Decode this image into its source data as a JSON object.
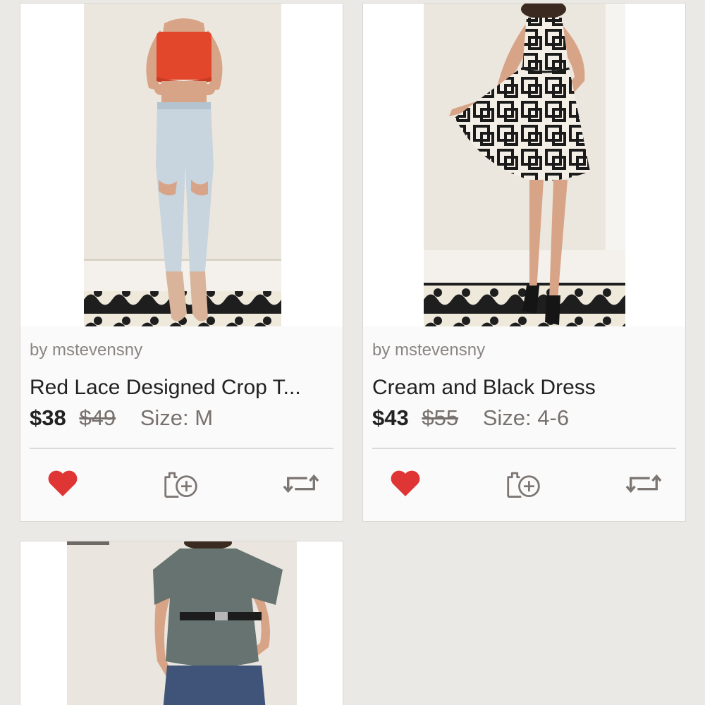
{
  "colors": {
    "background": "#ebe9e5",
    "card": "#ffffff",
    "heart": "#e03535",
    "icon_gray": "#7c7673",
    "text": "#222222",
    "muted": "#77716e"
  },
  "listings": [
    {
      "seller": "by mstevensny",
      "title": "Red Lace Designed Crop T...",
      "price": "$38",
      "original_price": "$49",
      "size": "Size: M",
      "image_alt": "Woman in red lace crop top and light ripped jeans",
      "icons": [
        "heart-icon",
        "bundle-add-icon",
        "share-icon"
      ]
    },
    {
      "seller": "by mstevensny",
      "title": "Cream and Black Dress",
      "price": "$43",
      "original_price": "$55",
      "size": "Size: 4-6",
      "image_alt": "Woman in cream and black geometric print dress",
      "icons": [
        "heart-icon",
        "bundle-add-icon",
        "share-icon"
      ]
    },
    {
      "image_alt": "Woman in gray belted top and jeans"
    }
  ]
}
